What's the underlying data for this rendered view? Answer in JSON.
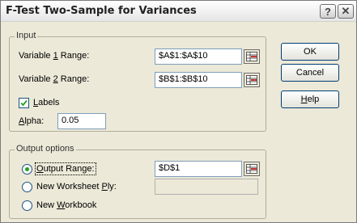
{
  "window": {
    "title": "F-Test Two-Sample for Variances",
    "help_glyph": "?",
    "close_glyph": "✕"
  },
  "input_group": {
    "label": "Input",
    "var1": {
      "label_pre": "Variable ",
      "label_key": "1",
      "label_post": " Range:",
      "value": "$A$1:$A$10"
    },
    "var2": {
      "label_pre": "Variable ",
      "label_key": "2",
      "label_post": " Range:",
      "value": "$B$1:$B$10"
    },
    "labels": {
      "label_key": "L",
      "label_post": "abels",
      "checked": true
    },
    "alpha": {
      "label_key": "A",
      "label_post": "lpha:",
      "value": "0.05"
    }
  },
  "output_group": {
    "label": "Output options",
    "output_range": {
      "label_key": "O",
      "label_post": "utput Range:",
      "value": "$D$1",
      "selected": true
    },
    "new_sheet": {
      "label_pre": "New Worksheet ",
      "label_key": "P",
      "label_post": "ly:",
      "value": "",
      "selected": false
    },
    "new_workbook": {
      "label_pre": "New ",
      "label_key": "W",
      "label_post": "orkbook",
      "selected": false
    }
  },
  "buttons": {
    "ok": "OK",
    "cancel": "Cancel",
    "help_key": "H",
    "help_post": "elp"
  },
  "icons": {
    "ref_icon": "range-selector-icon",
    "check_icon": "checkmark-icon"
  },
  "colors": {
    "dialog_bg": "#ece9d8",
    "field_border": "#7f9db9",
    "radio_dot": "#21a121"
  }
}
